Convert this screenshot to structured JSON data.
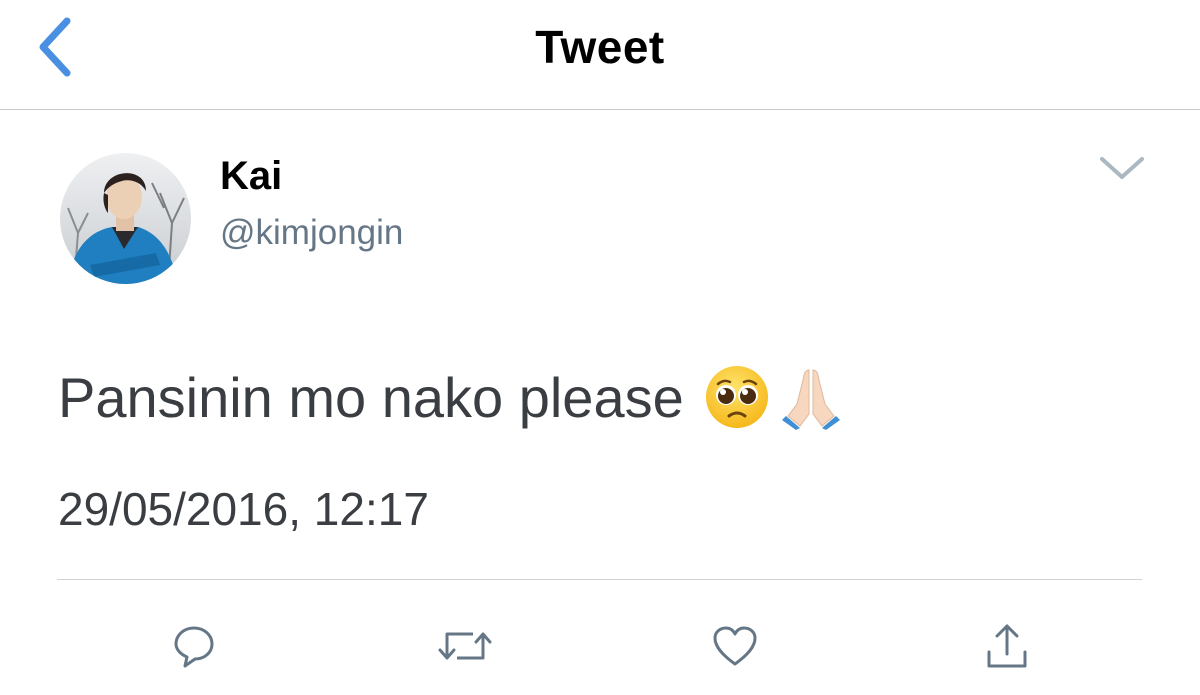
{
  "header": {
    "title": "Tweet",
    "back_icon": "chevron-left-icon",
    "accent_color": "#4a90e2"
  },
  "tweet": {
    "author": {
      "name": "Kai",
      "handle": "@kimjongin"
    },
    "text": "Pansinin mo nako please",
    "emojis": [
      "pleading-face-icon",
      "folded-hands-icon"
    ],
    "timestamp": "29/05/2016, 12:17",
    "menu_icon": "chevron-down-icon"
  },
  "actions": [
    {
      "name": "reply",
      "icon": "speech-bubble-icon"
    },
    {
      "name": "retweet",
      "icon": "retweet-arrows-icon"
    },
    {
      "name": "like",
      "icon": "heart-icon"
    },
    {
      "name": "share",
      "icon": "share-upload-icon"
    }
  ],
  "colors": {
    "icon_gray": "#657786",
    "text": "#3a3d41",
    "divider": "#cfd3d6"
  }
}
